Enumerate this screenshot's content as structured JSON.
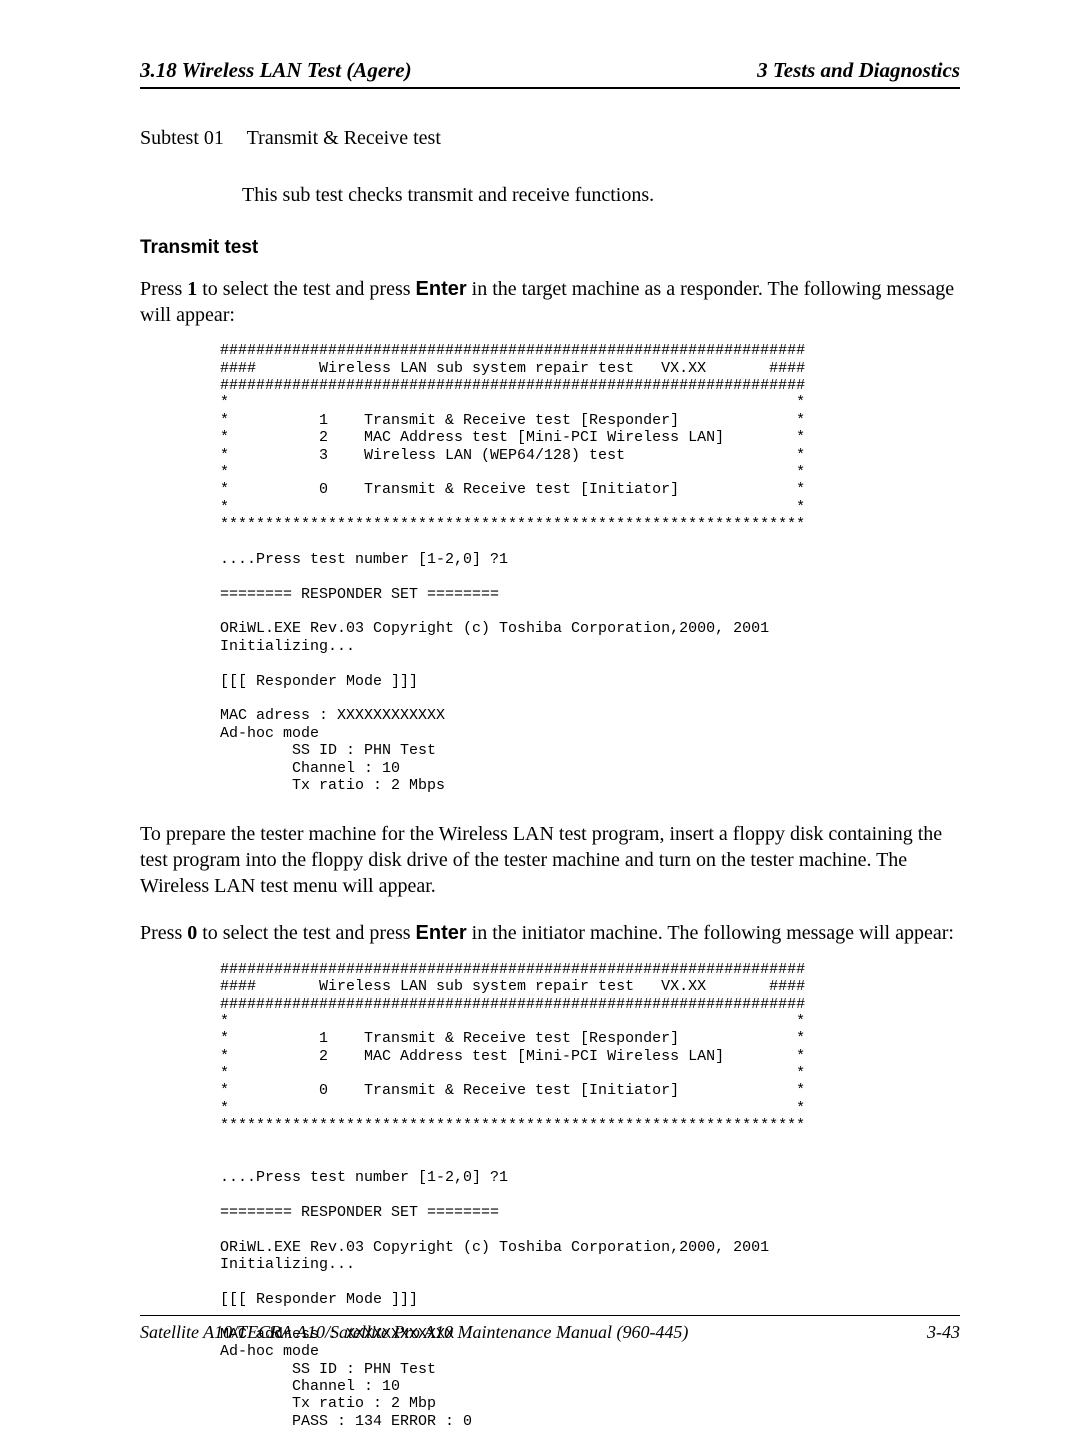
{
  "header": {
    "left": "3.18  Wireless LAN Test  (Agere)",
    "right": "3 Tests and Diagnostics"
  },
  "subtest": {
    "label": "Subtest 01",
    "name": "Transmit & Receive test",
    "desc": "This sub test checks transmit and receive functions."
  },
  "section_title": "Transmit test",
  "para1_a": "Press ",
  "para1_b": "1",
  "para1_c": " to select the test and press ",
  "para1_d": "Enter",
  "para1_e": " in the target machine as a responder. The following message will appear:",
  "code1": "#################################################################\n####       Wireless LAN sub system repair test   VX.XX       ####\n#################################################################\n*                                                               *\n*          1    Transmit & Receive test [Responder]             *\n*          2    MAC Address test [Mini-PCI Wireless LAN]        *\n*          3    Wireless LAN (WEP64/128) test                   *\n*                                                               *\n*          0    Transmit & Receive test [Initiator]             *\n*                                                               *\n*****************************************************************\n\n....Press test number [1-2,0] ?1\n\n======== RESPONDER SET ========\n\nORiWL.EXE Rev.03 Copyright (c) Toshiba Corporation,2000, 2001\nInitializing...\n\n[[[ Responder Mode ]]]\n\nMAC adress : XXXXXXXXXXXX\nAd-hoc mode\n        SS ID : PHN Test\n        Channel : 10\n        Tx ratio : 2 Mbps",
  "para2": "To prepare the tester machine for the Wireless LAN test program, insert a floppy disk containing the test program into the floppy disk drive of the tester machine and turn on the tester machine. The Wireless LAN test menu will appear.",
  "para3_a": "Press ",
  "para3_b": "0",
  "para3_c": " to select the test and press ",
  "para3_d": "Enter",
  "para3_e": " in the initiator machine. The following message will appear:",
  "code2": "#################################################################\n####       Wireless LAN sub system repair test   VX.XX       ####\n#################################################################\n*                                                               *\n*          1    Transmit & Receive test [Responder]             *\n*          2    MAC Address test [Mini-PCI Wireless LAN]        *\n*                                                               *\n*          0    Transmit & Receive test [Initiator]             *\n*                                                               *\n*****************************************************************\n\n\n....Press test number [1-2,0] ?1\n\n======== RESPONDER SET ========\n\nORiWL.EXE Rev.03 Copyright (c) Toshiba Corporation,2000, 2001\nInitializing...\n\n[[[ Responder Mode ]]]\n\nMAC address : XXXXXXXXXXXX\nAd-hoc mode\n        SS ID : PHN Test\n        Channel : 10\n        Tx ratio : 2 Mbp\n        PASS : 134 ERROR : 0",
  "footer": {
    "left": "Satellite A10/TECRA A10/Satellite Pro A10  Maintenance Manual (960-445)",
    "right": "3-43"
  }
}
